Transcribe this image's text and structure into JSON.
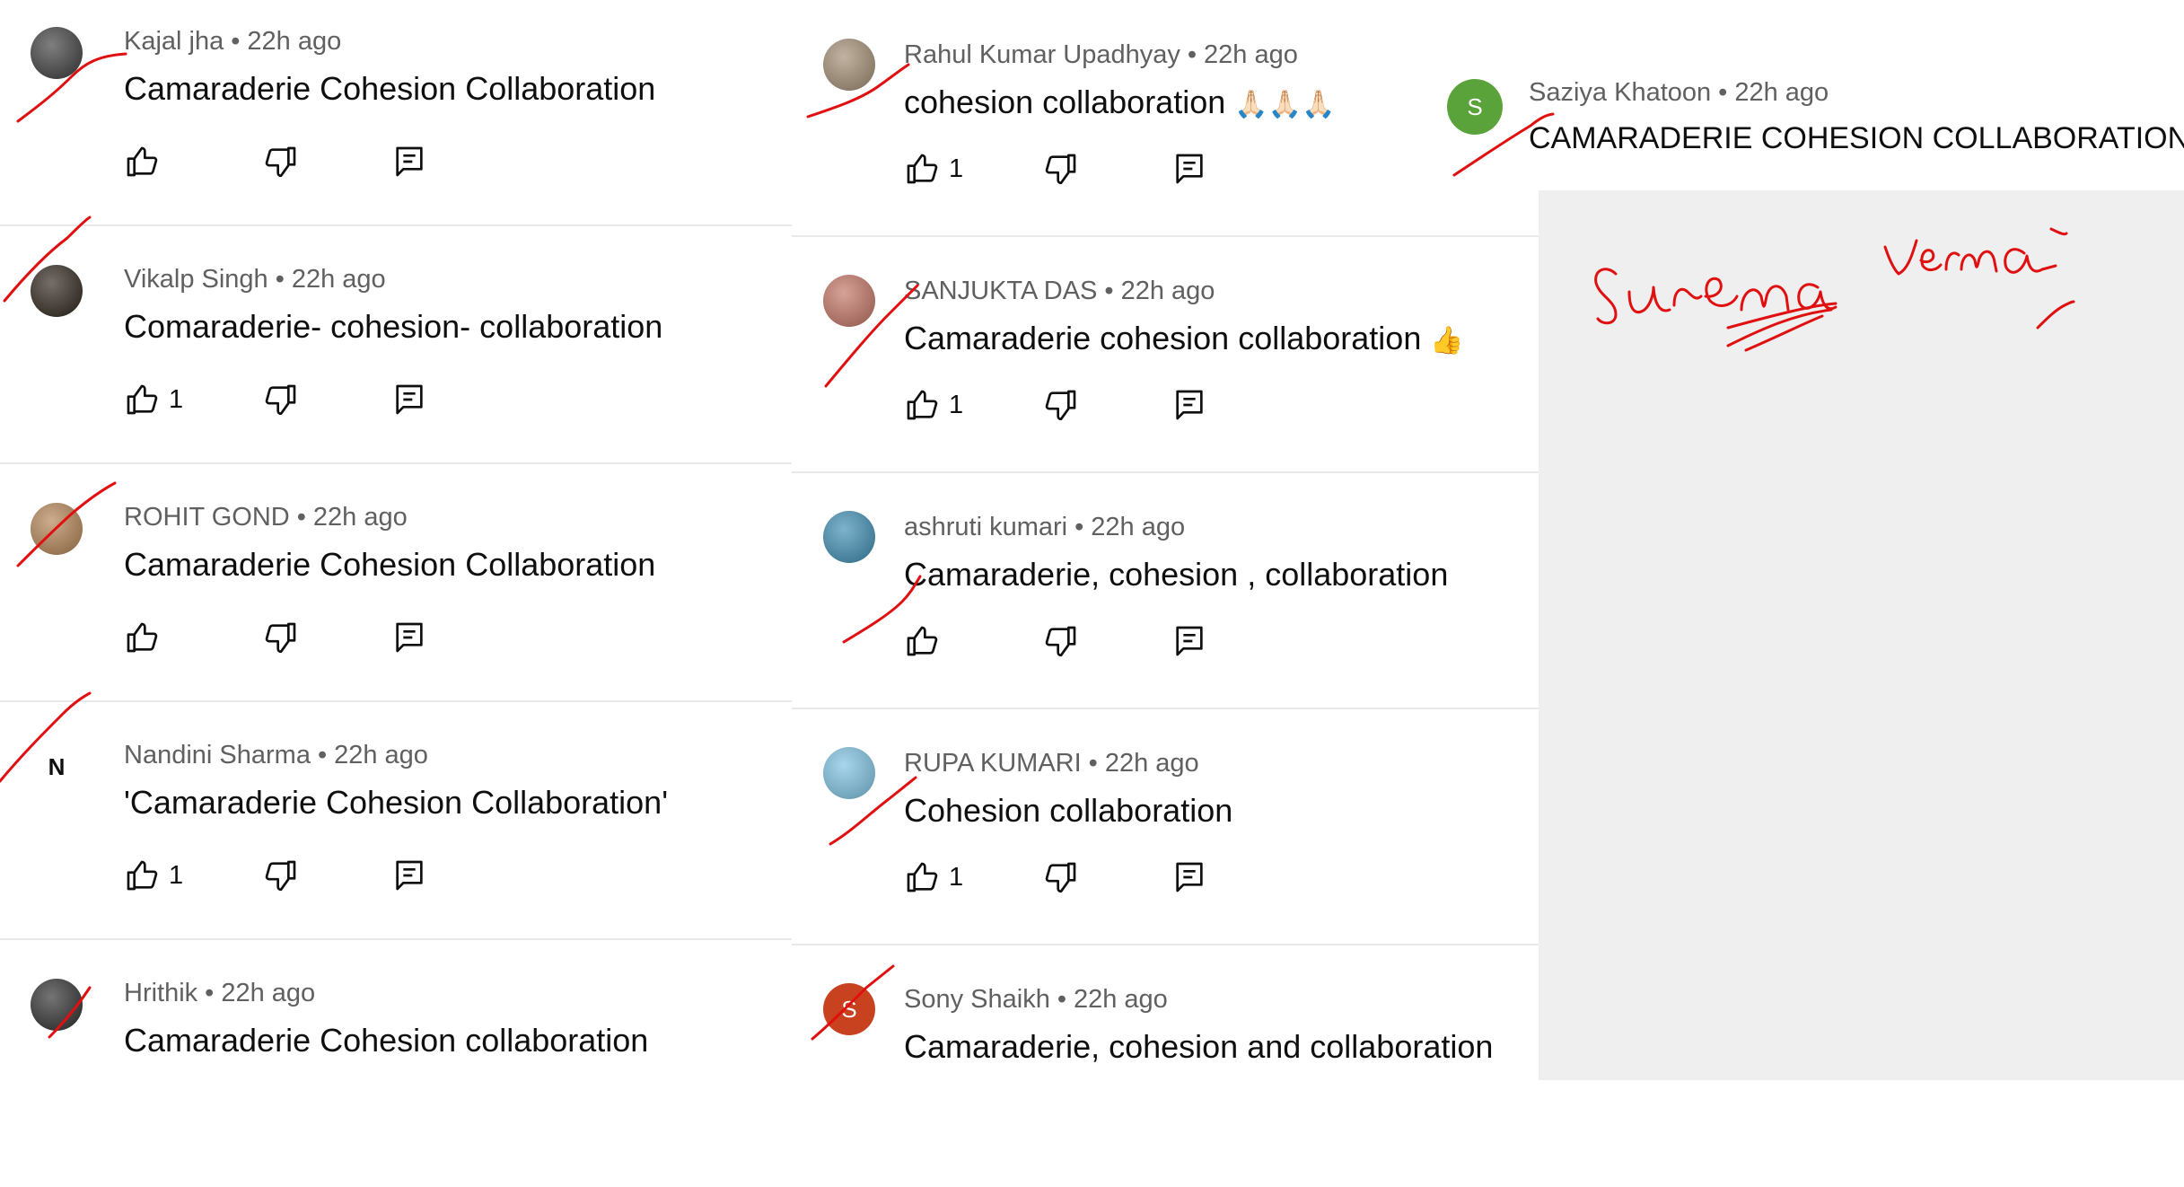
{
  "comments_left": [
    {
      "author": "Kajal jha",
      "age": "22h ago",
      "text": "Camaraderie Cohesion Collaboration",
      "likes": "",
      "avatar_type": "photo",
      "avatar_color": "#3a3a3a"
    },
    {
      "author": "Vikalp Singh",
      "age": "22h ago",
      "text": "Comaraderie- cohesion- collaboration",
      "likes": "1",
      "avatar_type": "photo",
      "avatar_color": "#2b2118"
    },
    {
      "author": "ROHIT GOND",
      "age": "22h ago",
      "text": "Camaraderie Cohesion Collaboration",
      "likes": "",
      "avatar_type": "photo",
      "avatar_color": "#b08050"
    },
    {
      "author": "Nandini Sharma",
      "age": "22h ago",
      "text": "'Camaraderie Cohesion Collaboration'",
      "likes": "1",
      "avatar_type": "letter",
      "avatar_letter": "N",
      "avatar_color": "#ffffff"
    },
    {
      "author": "Hrithik",
      "age": "22h ago",
      "text": "Camaraderie Cohesion collaboration",
      "likes": "",
      "avatar_type": "photo",
      "avatar_color": "#2a2a2a"
    }
  ],
  "comments_middle": [
    {
      "author": "Rahul Kumar Upadhyay",
      "age": "22h ago",
      "text": "cohesion collaboration",
      "emoji": "🙏🏻🙏🏻🙏🏻",
      "likes": "1",
      "avatar_type": "photo",
      "avatar_color": "#a08a70"
    },
    {
      "author": "SANJUKTA DAS",
      "age": "22h ago",
      "text": "Camaraderie cohesion collaboration",
      "emoji": "👍",
      "likes": "1",
      "avatar_type": "photo",
      "avatar_color": "#c07060"
    },
    {
      "author": "ashruti kumari",
      "age": "22h ago",
      "text": "Camaraderie, cohesion , collaboration",
      "emoji": "",
      "likes": "",
      "avatar_type": "photo",
      "avatar_color": "#3a8ab0"
    },
    {
      "author": "RUPA KUMARI",
      "age": "22h ago",
      "text": "Cohesion collaboration",
      "emoji": "",
      "likes": "1",
      "avatar_type": "photo",
      "avatar_color": "#7ac0e0"
    },
    {
      "author": "Sony Shaikh",
      "age": "22h ago",
      "text": "Camaraderie, cohesion and collaboration",
      "emoji": "",
      "likes": "",
      "avatar_type": "letter",
      "avatar_letter": "S",
      "avatar_color": "#c8421f"
    }
  ],
  "comment_right": {
    "author": "Saziya  Khatoon",
    "age": "22h ago",
    "text": "CAMARADERIE COHESION COLLABORATION",
    "avatar_letter": "S",
    "avatar_color": "#5aa33a"
  },
  "separator": "•",
  "icons": {
    "like": "thumb-up-icon",
    "dislike": "thumb-down-icon",
    "reply": "reply-icon"
  },
  "handwriting": {
    "name": "Surema Verma",
    "ink_color": "#e01010"
  }
}
